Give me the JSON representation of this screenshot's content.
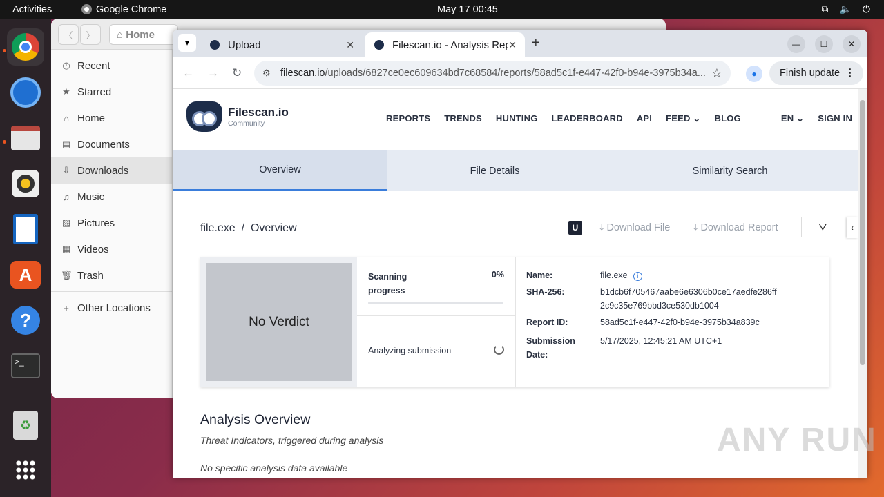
{
  "topbar": {
    "activities": "Activities",
    "app_name": "Google Chrome",
    "clock": "May 17  00:45"
  },
  "dock": {
    "items": [
      "chrome-icon",
      "thunderbird-icon",
      "files-icon",
      "rhythmbox-icon",
      "writer-icon",
      "app-center-icon",
      "help-icon",
      "terminal-icon",
      "trash-icon",
      "app-grid-icon"
    ]
  },
  "files": {
    "path_label": "Home",
    "sidebar": [
      {
        "icon": "◷",
        "label": "Recent"
      },
      {
        "icon": "★",
        "label": "Starred"
      },
      {
        "icon": "⌂",
        "label": "Home"
      },
      {
        "icon": "▤",
        "label": "Documents"
      },
      {
        "icon": "⇩",
        "label": "Downloads"
      },
      {
        "icon": "♫",
        "label": "Music"
      },
      {
        "icon": "▨",
        "label": "Pictures"
      },
      {
        "icon": "▦",
        "label": "Videos"
      },
      {
        "icon": "🗑",
        "label": "Trash"
      },
      {
        "icon": "+",
        "label": "Other Locations"
      }
    ]
  },
  "browser": {
    "tabs": [
      {
        "title": "Upload"
      },
      {
        "title": "Filescan.io - Analysis Rep"
      }
    ],
    "url_host": "filescan.io",
    "url_path": "/uploads/6827ce0ec609634bd7c68584/reports/58ad5c1f-e447-42f0-b94e-3975b34a...",
    "finish_update": "Finish update"
  },
  "site": {
    "brand": "Filescan.io",
    "brand_sub": "Community",
    "menu": [
      "REPORTS",
      "TRENDS",
      "HUNTING",
      "LEADERBOARD",
      "API",
      "FEED"
    ],
    "blog": "BLOG",
    "lang": "EN",
    "signin": "SIGN IN",
    "subtabs": [
      "Overview",
      "File Details",
      "Similarity Search"
    ],
    "crumb_file": "file.exe",
    "crumb_sep": "/",
    "crumb_page": "Overview",
    "badge": "U",
    "download_file": "Download File",
    "download_report": "Download Report",
    "verdict": "No Verdict",
    "scanning_label": "Scanning progress",
    "scanning_pct": "0%",
    "scanning_value": 0,
    "analyzing": "Analyzing submission",
    "info": {
      "name_k": "Name:",
      "name_v": "file.exe",
      "sha_k": "SHA-256:",
      "sha_v1": "b1dcb6f705467aabe6e6306b0ce17aedfe286ff",
      "sha_v2": "2c9c35e769bbd3ce530db1004",
      "rid_k": "Report ID:",
      "rid_v": "58ad5c1f-e447-42f0-b94e-3975b34a839c",
      "sub_k1": "Submission",
      "sub_k2": "Date:",
      "sub_v": "5/17/2025, 12:45:21 AM UTC+1"
    },
    "analysis_title": "Analysis Overview",
    "analysis_sub": "Threat Indicators, triggered during analysis",
    "analysis_none": "No specific analysis data available"
  },
  "watermark": "ANY RUN"
}
